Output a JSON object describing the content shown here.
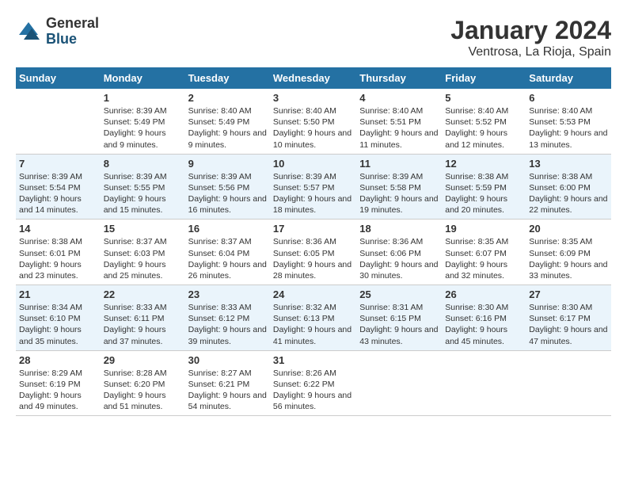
{
  "logo": {
    "general": "General",
    "blue": "Blue"
  },
  "title": "January 2024",
  "subtitle": "Ventrosa, La Rioja, Spain",
  "weekdays": [
    "Sunday",
    "Monday",
    "Tuesday",
    "Wednesday",
    "Thursday",
    "Friday",
    "Saturday"
  ],
  "weeks": [
    [
      {
        "num": "",
        "sunrise": "",
        "sunset": "",
        "daylight": ""
      },
      {
        "num": "1",
        "sunrise": "Sunrise: 8:39 AM",
        "sunset": "Sunset: 5:49 PM",
        "daylight": "Daylight: 9 hours and 9 minutes."
      },
      {
        "num": "2",
        "sunrise": "Sunrise: 8:40 AM",
        "sunset": "Sunset: 5:49 PM",
        "daylight": "Daylight: 9 hours and 9 minutes."
      },
      {
        "num": "3",
        "sunrise": "Sunrise: 8:40 AM",
        "sunset": "Sunset: 5:50 PM",
        "daylight": "Daylight: 9 hours and 10 minutes."
      },
      {
        "num": "4",
        "sunrise": "Sunrise: 8:40 AM",
        "sunset": "Sunset: 5:51 PM",
        "daylight": "Daylight: 9 hours and 11 minutes."
      },
      {
        "num": "5",
        "sunrise": "Sunrise: 8:40 AM",
        "sunset": "Sunset: 5:52 PM",
        "daylight": "Daylight: 9 hours and 12 minutes."
      },
      {
        "num": "6",
        "sunrise": "Sunrise: 8:40 AM",
        "sunset": "Sunset: 5:53 PM",
        "daylight": "Daylight: 9 hours and 13 minutes."
      }
    ],
    [
      {
        "num": "7",
        "sunrise": "Sunrise: 8:39 AM",
        "sunset": "Sunset: 5:54 PM",
        "daylight": "Daylight: 9 hours and 14 minutes."
      },
      {
        "num": "8",
        "sunrise": "Sunrise: 8:39 AM",
        "sunset": "Sunset: 5:55 PM",
        "daylight": "Daylight: 9 hours and 15 minutes."
      },
      {
        "num": "9",
        "sunrise": "Sunrise: 8:39 AM",
        "sunset": "Sunset: 5:56 PM",
        "daylight": "Daylight: 9 hours and 16 minutes."
      },
      {
        "num": "10",
        "sunrise": "Sunrise: 8:39 AM",
        "sunset": "Sunset: 5:57 PM",
        "daylight": "Daylight: 9 hours and 18 minutes."
      },
      {
        "num": "11",
        "sunrise": "Sunrise: 8:39 AM",
        "sunset": "Sunset: 5:58 PM",
        "daylight": "Daylight: 9 hours and 19 minutes."
      },
      {
        "num": "12",
        "sunrise": "Sunrise: 8:38 AM",
        "sunset": "Sunset: 5:59 PM",
        "daylight": "Daylight: 9 hours and 20 minutes."
      },
      {
        "num": "13",
        "sunrise": "Sunrise: 8:38 AM",
        "sunset": "Sunset: 6:00 PM",
        "daylight": "Daylight: 9 hours and 22 minutes."
      }
    ],
    [
      {
        "num": "14",
        "sunrise": "Sunrise: 8:38 AM",
        "sunset": "Sunset: 6:01 PM",
        "daylight": "Daylight: 9 hours and 23 minutes."
      },
      {
        "num": "15",
        "sunrise": "Sunrise: 8:37 AM",
        "sunset": "Sunset: 6:03 PM",
        "daylight": "Daylight: 9 hours and 25 minutes."
      },
      {
        "num": "16",
        "sunrise": "Sunrise: 8:37 AM",
        "sunset": "Sunset: 6:04 PM",
        "daylight": "Daylight: 9 hours and 26 minutes."
      },
      {
        "num": "17",
        "sunrise": "Sunrise: 8:36 AM",
        "sunset": "Sunset: 6:05 PM",
        "daylight": "Daylight: 9 hours and 28 minutes."
      },
      {
        "num": "18",
        "sunrise": "Sunrise: 8:36 AM",
        "sunset": "Sunset: 6:06 PM",
        "daylight": "Daylight: 9 hours and 30 minutes."
      },
      {
        "num": "19",
        "sunrise": "Sunrise: 8:35 AM",
        "sunset": "Sunset: 6:07 PM",
        "daylight": "Daylight: 9 hours and 32 minutes."
      },
      {
        "num": "20",
        "sunrise": "Sunrise: 8:35 AM",
        "sunset": "Sunset: 6:09 PM",
        "daylight": "Daylight: 9 hours and 33 minutes."
      }
    ],
    [
      {
        "num": "21",
        "sunrise": "Sunrise: 8:34 AM",
        "sunset": "Sunset: 6:10 PM",
        "daylight": "Daylight: 9 hours and 35 minutes."
      },
      {
        "num": "22",
        "sunrise": "Sunrise: 8:33 AM",
        "sunset": "Sunset: 6:11 PM",
        "daylight": "Daylight: 9 hours and 37 minutes."
      },
      {
        "num": "23",
        "sunrise": "Sunrise: 8:33 AM",
        "sunset": "Sunset: 6:12 PM",
        "daylight": "Daylight: 9 hours and 39 minutes."
      },
      {
        "num": "24",
        "sunrise": "Sunrise: 8:32 AM",
        "sunset": "Sunset: 6:13 PM",
        "daylight": "Daylight: 9 hours and 41 minutes."
      },
      {
        "num": "25",
        "sunrise": "Sunrise: 8:31 AM",
        "sunset": "Sunset: 6:15 PM",
        "daylight": "Daylight: 9 hours and 43 minutes."
      },
      {
        "num": "26",
        "sunrise": "Sunrise: 8:30 AM",
        "sunset": "Sunset: 6:16 PM",
        "daylight": "Daylight: 9 hours and 45 minutes."
      },
      {
        "num": "27",
        "sunrise": "Sunrise: 8:30 AM",
        "sunset": "Sunset: 6:17 PM",
        "daylight": "Daylight: 9 hours and 47 minutes."
      }
    ],
    [
      {
        "num": "28",
        "sunrise": "Sunrise: 8:29 AM",
        "sunset": "Sunset: 6:19 PM",
        "daylight": "Daylight: 9 hours and 49 minutes."
      },
      {
        "num": "29",
        "sunrise": "Sunrise: 8:28 AM",
        "sunset": "Sunset: 6:20 PM",
        "daylight": "Daylight: 9 hours and 51 minutes."
      },
      {
        "num": "30",
        "sunrise": "Sunrise: 8:27 AM",
        "sunset": "Sunset: 6:21 PM",
        "daylight": "Daylight: 9 hours and 54 minutes."
      },
      {
        "num": "31",
        "sunrise": "Sunrise: 8:26 AM",
        "sunset": "Sunset: 6:22 PM",
        "daylight": "Daylight: 9 hours and 56 minutes."
      },
      {
        "num": "",
        "sunrise": "",
        "sunset": "",
        "daylight": ""
      },
      {
        "num": "",
        "sunrise": "",
        "sunset": "",
        "daylight": ""
      },
      {
        "num": "",
        "sunrise": "",
        "sunset": "",
        "daylight": ""
      }
    ]
  ]
}
